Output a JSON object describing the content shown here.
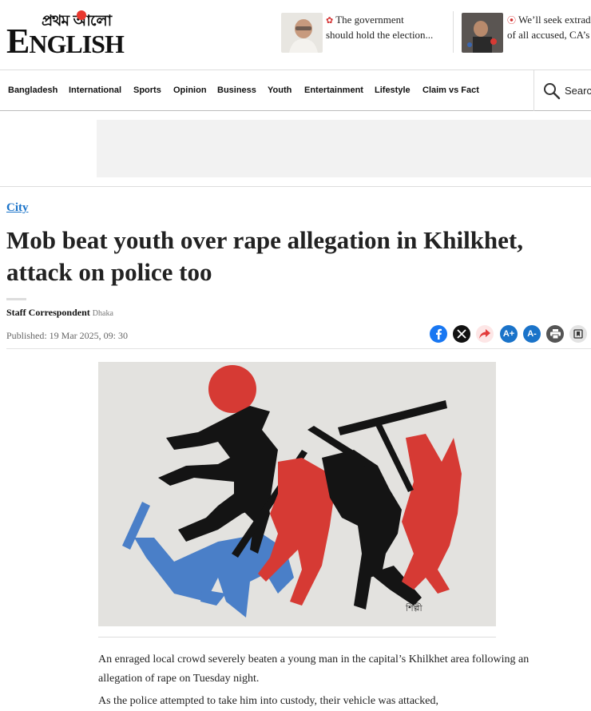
{
  "brand": {
    "bengali_logo": "প্রথম আলো",
    "english_logo_initial": "E",
    "english_logo_rest": "NGLISH"
  },
  "top_news": [
    {
      "line1": "The government",
      "line2": "should hold the election...",
      "icon": "photo-gallery-icon"
    },
    {
      "line1": "We’ll seek extrad",
      "line2": "of all accused, CA’s",
      "icon": "video-icon"
    }
  ],
  "nav": {
    "items": [
      "Bangladesh",
      "International",
      "Sports",
      "Opinion",
      "Business",
      "Youth",
      "Entertainment",
      "Lifestyle",
      "Claim vs Fact"
    ],
    "search_label": "Search"
  },
  "article": {
    "section": "City",
    "headline": "Mob beat youth over rape allegation in Khilkhet, attack on police too",
    "author": "Staff Correspondent",
    "location": "Dhaka",
    "published": "Published: 19 Mar 2025, 09: 30",
    "paragraphs": [
      "An enraged local crowd severely beaten a young man in the capital’s Khilkhet area following an allegation of rape on Tuesday night.",
      "As the police attempted to take him into custody, their vehicle was attacked,"
    ]
  },
  "share": {
    "facebook": "facebook-icon",
    "x": "x-icon",
    "share": "share-icon",
    "font_increase": "A+",
    "font_decrease": "A-",
    "print": "print-icon",
    "bookmark": "bookmark-icon"
  },
  "colors": {
    "accent_blue": "#1a73c9",
    "facebook": "#1877f2",
    "red": "#d63a34",
    "figure_black": "#141414",
    "figure_blue": "#4a7fc8"
  }
}
